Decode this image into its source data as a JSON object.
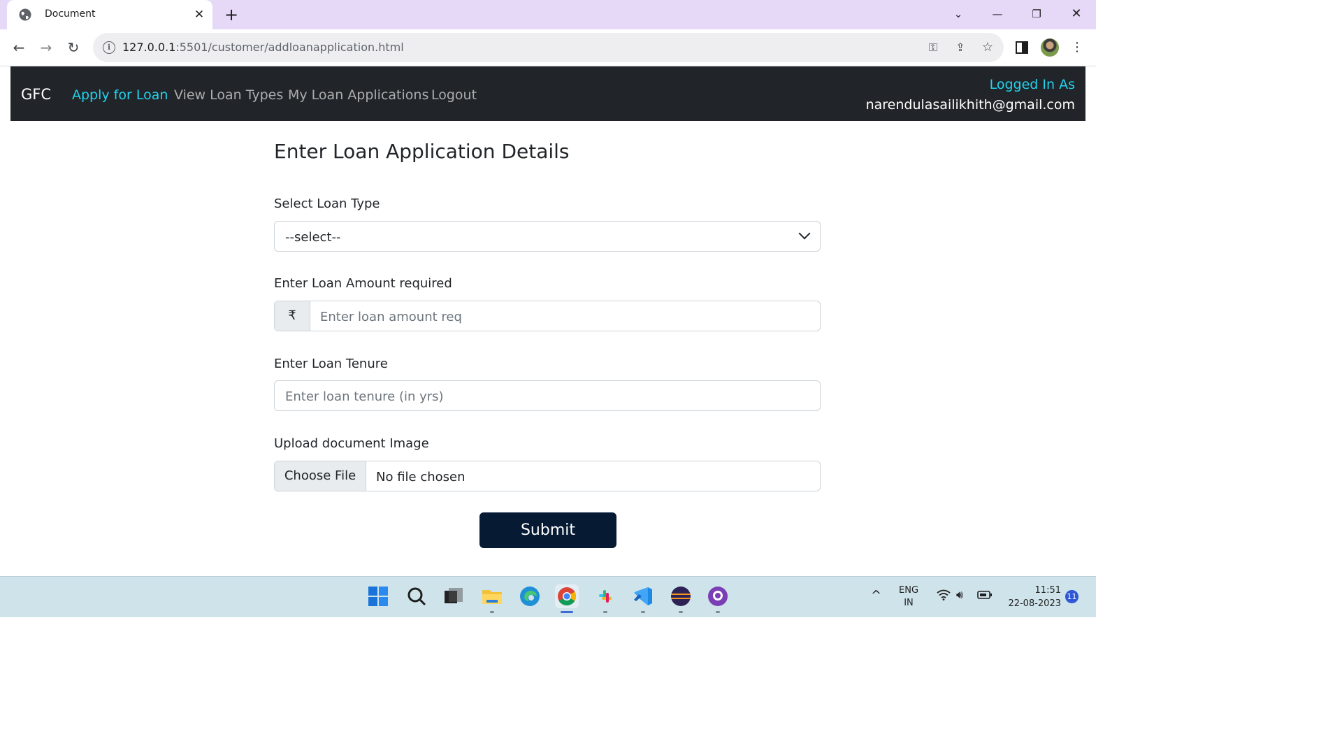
{
  "browser": {
    "tab_title": "Document",
    "url_host": "127.0.0.1",
    "url_path": ":5501/customer/addloanapplication.html"
  },
  "navbar": {
    "brand": "GFC",
    "links": [
      {
        "label": "Apply for Loan",
        "active": true
      },
      {
        "label": "View Loan Types",
        "active": false
      },
      {
        "label": "My Loan Applications",
        "active": false
      },
      {
        "label": "Logout",
        "active": false
      }
    ],
    "logged_in_label": "Logged In As",
    "logged_in_user": "narendulasailikhith@gmail.com"
  },
  "form": {
    "heading": "Enter Loan Application Details",
    "loan_type_label": "Select Loan Type",
    "loan_type_selected": "--select--",
    "amount_label": "Enter Loan Amount required",
    "currency_symbol": "₹",
    "amount_placeholder": "Enter loan amount req",
    "tenure_label": "Enter Loan Tenure",
    "tenure_placeholder": "Enter loan tenure (in yrs)",
    "upload_label": "Upload document Image",
    "file_button": "Choose File",
    "file_status": "No file chosen",
    "submit_label": "Submit"
  },
  "taskbar": {
    "apps": [
      "windows-start-icon",
      "search-icon",
      "task-view-icon",
      "file-explorer-icon",
      "edge-icon",
      "chrome-icon",
      "slack-icon",
      "vscode-icon",
      "eclipse-icon",
      "github-desktop-icon"
    ],
    "language": "ENG",
    "region": "IN",
    "time": "11:51",
    "date": "22-08-2023",
    "notification_count": "11"
  },
  "colors": {
    "navbar_bg": "#212529",
    "active_link": "#22d3ee",
    "submit_bg": "#061a33",
    "tabstrip_bg": "#e6d9f8"
  }
}
